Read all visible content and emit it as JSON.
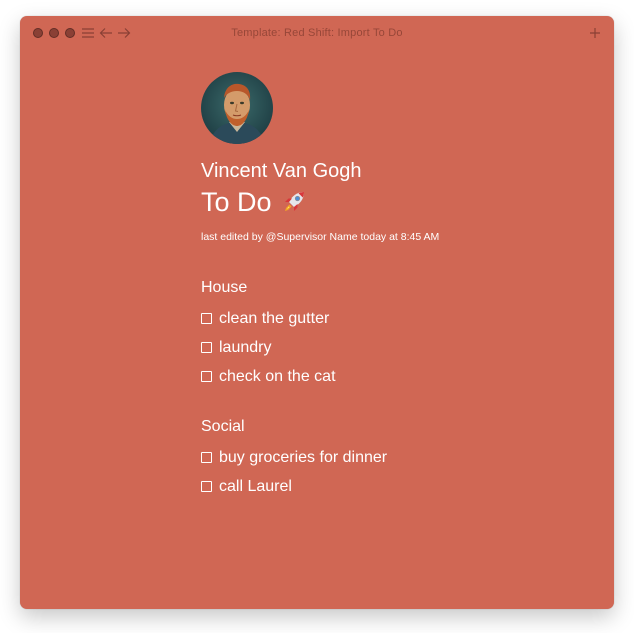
{
  "window": {
    "title": "Template: Red Shift: Import To Do",
    "background": "#d06754"
  },
  "toolbar": {
    "menu_icon": "hamburger-menu-icon",
    "back_icon": "arrow-left-icon",
    "forward_icon": "arrow-right-icon",
    "add_icon": "plus-icon"
  },
  "header": {
    "avatar": "portrait-avatar",
    "owner_name": "Vincent Van Gogh",
    "title": "To Do",
    "title_icon": "rocket-emoji",
    "meta": "last edited by @Supervisor Name today at 8:45 AM"
  },
  "sections": [
    {
      "title": "House",
      "tasks": [
        {
          "label": "clean the gutter",
          "checked": false
        },
        {
          "label": "laundry",
          "checked": false
        },
        {
          "label": "check on the cat",
          "checked": false
        }
      ]
    },
    {
      "title": "Social",
      "tasks": [
        {
          "label": "buy groceries for dinner",
          "checked": false
        },
        {
          "label": "call Laurel",
          "checked": false
        }
      ]
    }
  ]
}
